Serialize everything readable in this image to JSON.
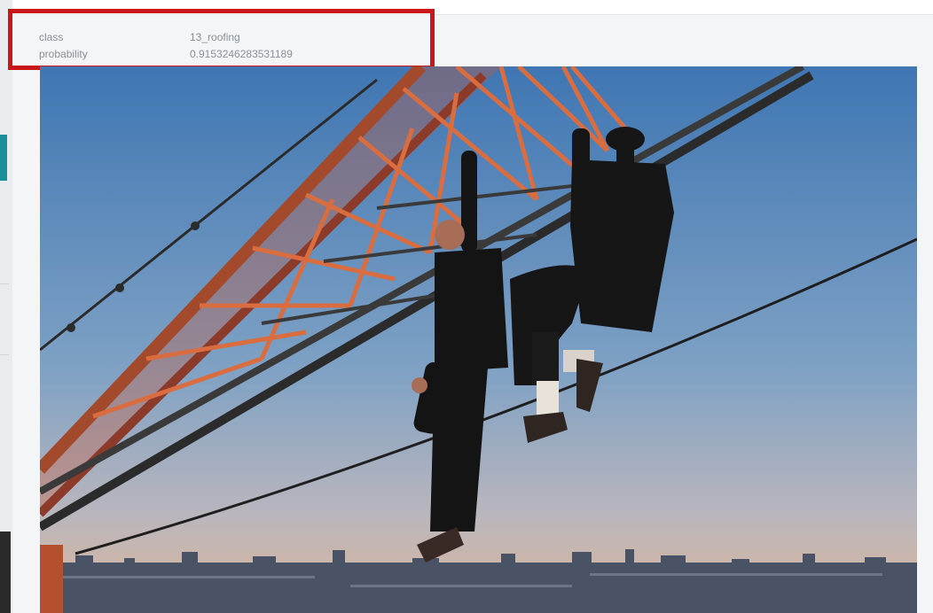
{
  "prediction": {
    "rows": [
      {
        "key": "class",
        "value": "13_roofing"
      },
      {
        "key": "probability",
        "value": "0.9153246283531189"
      }
    ]
  },
  "image": {
    "subject": "photo-roofers-hanging-from-crane",
    "colors": {
      "sky_top": "#3f76b3",
      "sky_mid": "#8aa8c6",
      "sky_horizon": "#d4b7a2",
      "crane": "#c85a3a",
      "city": "#4a5366"
    }
  },
  "colors": {
    "highlight": "#c8161b",
    "card_bg": "#f3f5f7",
    "text_muted": "#8a9099",
    "accent_teal": "#1a8f9a"
  }
}
